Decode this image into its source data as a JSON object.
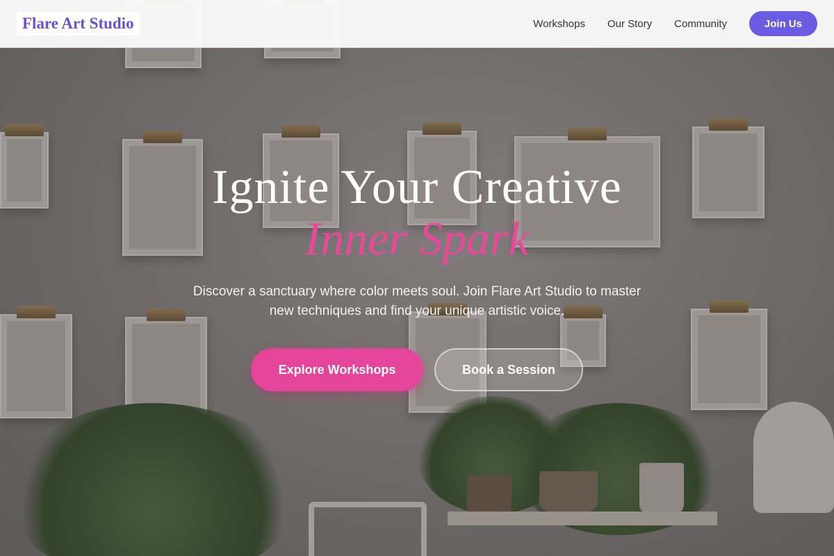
{
  "header": {
    "logo": "Flare Art Studio",
    "nav": [
      {
        "label": "Workshops"
      },
      {
        "label": "Our Story"
      },
      {
        "label": "Community"
      }
    ],
    "cta_label": "Join Us"
  },
  "hero": {
    "headline": "Ignite Your Creative",
    "headline_accent": "Inner Spark",
    "subtext": "Discover a sanctuary where color meets soul. Join Flare Art Studio to master new techniques and find your unique artistic voice.",
    "primary_cta": "Explore Workshops",
    "secondary_cta": "Book a Session"
  },
  "colors": {
    "brand": "#6a4fd8",
    "join_button": "#6b5be3",
    "accent_pink": "#e84a9a",
    "primary_cta": "#e4449a"
  }
}
